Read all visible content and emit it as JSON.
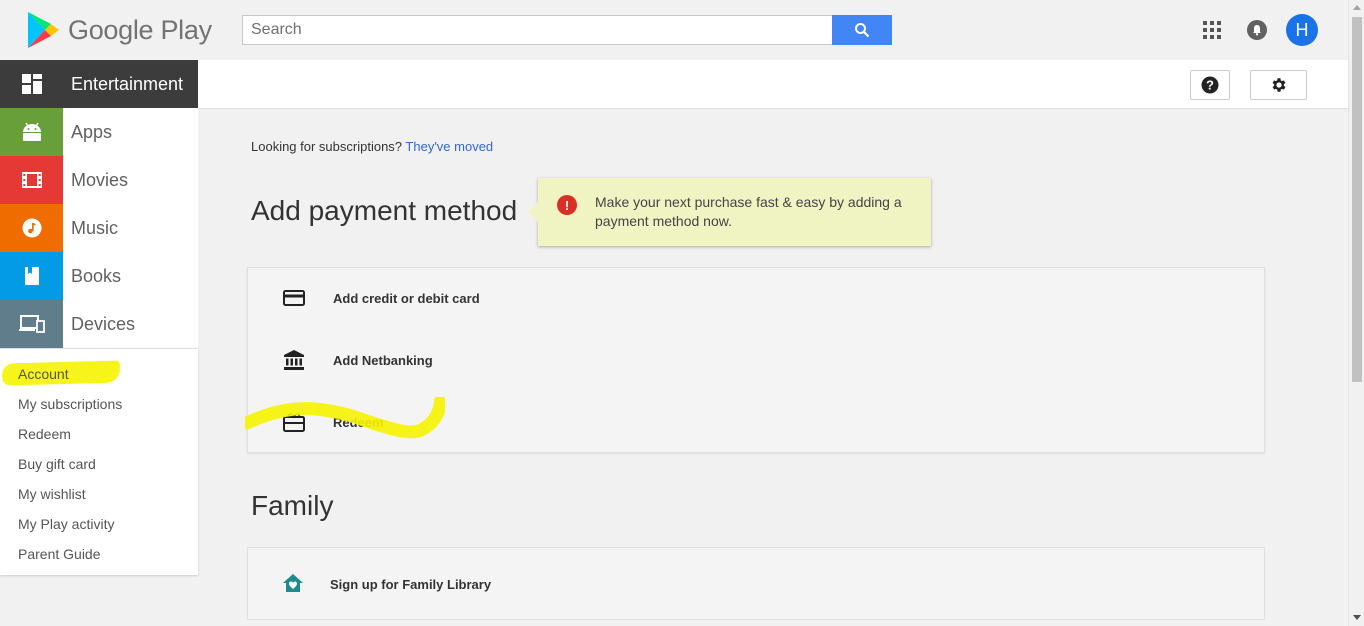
{
  "header": {
    "logo_text": "Google Play",
    "search_placeholder": "Search",
    "avatar_initial": "H"
  },
  "sidebar": {
    "items": [
      {
        "label": "Entertainment",
        "icon": "entertainment-grid-icon"
      },
      {
        "label": "Apps",
        "icon": "android-icon",
        "color": "#689f38"
      },
      {
        "label": "Movies",
        "icon": "film-icon",
        "color": "#e53935"
      },
      {
        "label": "Music",
        "icon": "music-note-icon",
        "color": "#ef6c00"
      },
      {
        "label": "Books",
        "icon": "book-icon",
        "color": "#039be5"
      },
      {
        "label": "Devices",
        "icon": "devices-icon",
        "color": "#607d8b"
      }
    ],
    "links": [
      "Account",
      "My subscriptions",
      "Redeem",
      "Buy gift card",
      "My wishlist",
      "My Play activity",
      "Parent Guide"
    ]
  },
  "main": {
    "notice_text": "Looking for subscriptions?",
    "notice_link": "They've moved",
    "payment_heading": "Add payment method",
    "tooltip_text": "Make your next purchase fast & easy by adding a payment method now.",
    "payment_options": [
      {
        "label": "Add credit or debit card",
        "icon": "credit-card-icon"
      },
      {
        "label": "Add Netbanking",
        "icon": "bank-icon"
      },
      {
        "label": "Redeem",
        "icon": "gift-card-icon"
      }
    ],
    "family_heading": "Family",
    "family_option": "Sign up for Family Library"
  },
  "colors": {
    "accent_blue": "#4285f4",
    "highlight_yellow": "#f6f300",
    "tooltip_bg": "#f0f4c3",
    "error_red": "#d93025",
    "family_icon": "#1e8a8a"
  }
}
